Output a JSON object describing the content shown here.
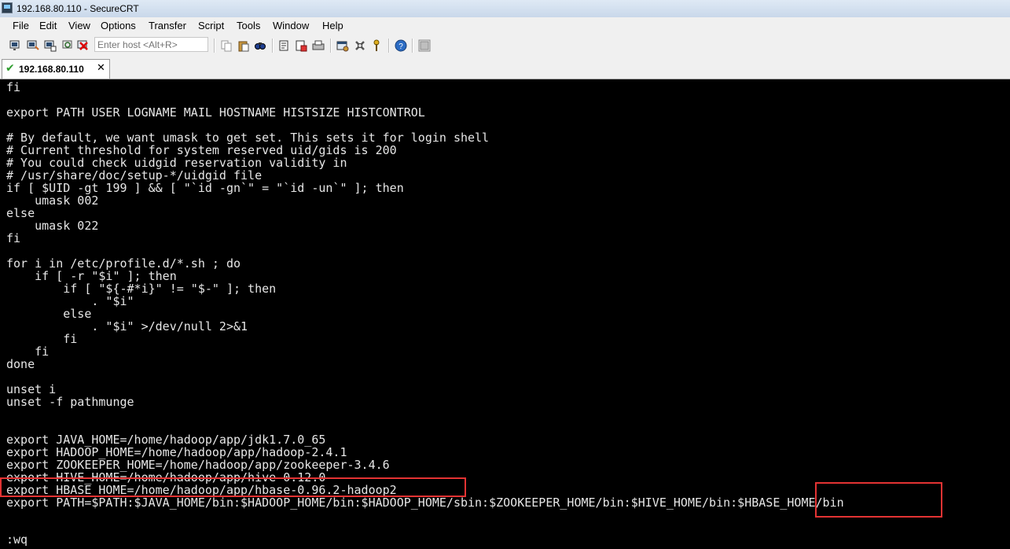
{
  "window": {
    "title": "192.168.80.110 - SecureCRT",
    "app_icon": "securecrt-icon"
  },
  "menu": {
    "items": [
      "File",
      "Edit",
      "View",
      "Options",
      "Transfer",
      "Script",
      "Tools",
      "Window",
      "Help"
    ]
  },
  "toolbar": {
    "host_placeholder": "Enter host <Alt+R>",
    "icons": [
      "connect-icon",
      "quick-connect-icon",
      "connect-in-tab-icon",
      "reconnect-icon",
      "disconnect-icon",
      "copy-icon",
      "paste-icon",
      "find-icon",
      "print-setup-icon",
      "print-icon",
      "print-screen-icon",
      "session-options-icon",
      "global-options-icon",
      "key-icon",
      "help-icon",
      "map-icon"
    ]
  },
  "tab": {
    "label": "192.168.80.110",
    "status_icon": "check-icon",
    "close_icon": "close-icon"
  },
  "terminal": {
    "lines": [
      "fi",
      "",
      "export PATH USER LOGNAME MAIL HOSTNAME HISTSIZE HISTCONTROL",
      "",
      "# By default, we want umask to get set. This sets it for login shell",
      "# Current threshold for system reserved uid/gids is 200",
      "# You could check uidgid reservation validity in",
      "# /usr/share/doc/setup-*/uidgid file",
      "if [ $UID -gt 199 ] && [ \"`id -gn`\" = \"`id -un`\" ]; then",
      "    umask 002",
      "else",
      "    umask 022",
      "fi",
      "",
      "for i in /etc/profile.d/*.sh ; do",
      "    if [ -r \"$i\" ]; then",
      "        if [ \"${-#*i}\" != \"$-\" ]; then",
      "            . \"$i\"",
      "        else",
      "            . \"$i\" >/dev/null 2>&1",
      "        fi",
      "    fi",
      "done",
      "",
      "unset i",
      "unset -f pathmunge",
      "",
      "",
      "export JAVA_HOME=/home/hadoop/app/jdk1.7.0_65",
      "export HADOOP_HOME=/home/hadoop/app/hadoop-2.4.1",
      "export ZOOKEEPER_HOME=/home/hadoop/app/zookeeper-3.4.6",
      "export HIVE_HOME=/home/hadoop/app/hive-0.12.0",
      "export HBASE_HOME=/home/hadoop/app/hbase-0.96.2-hadoop2",
      "export PATH=$PATH:$JAVA_HOME/bin:$HADOOP_HOME/bin:$HADOOP_HOME/sbin:$ZOOKEEPER_HOME/bin:$HIVE_HOME/bin:$HBASE_HOME/bin",
      "",
      "",
      ":wq"
    ]
  },
  "annotations": {
    "highlight_color": "#e33333"
  }
}
